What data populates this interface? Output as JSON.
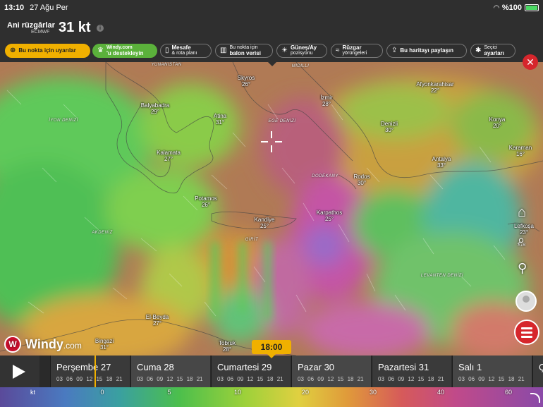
{
  "status": {
    "time": "13:10",
    "date": "27 Ağu Per",
    "battery": "%100"
  },
  "header": {
    "overlay": "Ani rüzgârlar",
    "model": "ECMWF",
    "value": "31 kt"
  },
  "toolbar": {
    "alert": "Bu nokta için uyarılar",
    "support_1": "Windy.com",
    "support_2": "'u destekleyin",
    "distance_1": "Mesafe",
    "distance_2": "& rota planı",
    "balloon_1": "Bu nokta için",
    "balloon_2": "balon verisi",
    "sun_1": "Güneş/Ay",
    "sun_2": "pozisyonu",
    "wind_1": "Rüzgar",
    "wind_2": "yörüngeleri",
    "share": "Bu haritayı paylaşın",
    "settings_1": "Seçici",
    "settings_2": "ayarları"
  },
  "map": {
    "cities": [
      {
        "name": "Balyabadra",
        "value": "29°"
      },
      {
        "name": "Atina",
        "value": "31°"
      },
      {
        "name": "Kalamata",
        "value": "27°"
      },
      {
        "name": "Skyros",
        "value": "26°"
      },
      {
        "name": "İzmir",
        "value": "28°"
      },
      {
        "name": "Afyonkarahisar",
        "value": "22°"
      },
      {
        "name": "Denizli",
        "value": "30°"
      },
      {
        "name": "Konya",
        "value": "20°"
      },
      {
        "name": "Karaman",
        "value": "16°"
      },
      {
        "name": "Antalya",
        "value": "33°"
      },
      {
        "name": "Rodos",
        "value": "30°"
      },
      {
        "name": "Potamos",
        "value": "26°"
      },
      {
        "name": "Kandiye",
        "value": "25°"
      },
      {
        "name": "Karpathos",
        "value": "25°"
      },
      {
        "name": "Lefkoşa",
        "value": "23°"
      },
      {
        "name": "El-Beyda",
        "value": "27°"
      },
      {
        "name": "Bingazi",
        "value": "31°"
      },
      {
        "name": "Tobruk",
        "value": "28°"
      }
    ],
    "seas": [
      "YUNANİSTAN",
      "MIDILLI",
      "İYON DENİZİ",
      "EGE DENİZİ",
      "DODEKANY",
      "AKDENİZ",
      "GİRİT",
      "LEVANTEN DENİZİ",
      "KIB"
    ]
  },
  "timeline": {
    "current_time": "18:00",
    "days": [
      {
        "name": "Perşembe 27",
        "hours": "03 06 09 12 15 18 21"
      },
      {
        "name": "Cuma 28",
        "hours": "03 06 09 12 15 18 21"
      },
      {
        "name": "Cumartesi 29",
        "hours": "03 06 09 12 15 18 21"
      },
      {
        "name": "Pazar 30",
        "hours": "03 06 09 12 15 18 21"
      },
      {
        "name": "Pazartesi 31",
        "hours": "03 06 09 12 15 18 21"
      },
      {
        "name": "Salı 1",
        "hours": "03 06 09 12 15 18 21"
      },
      {
        "name": "Ç",
        "hours": ""
      }
    ]
  },
  "legend": {
    "unit": "kt",
    "ticks": [
      "0",
      "5",
      "10",
      "20",
      "30",
      "40",
      "60"
    ]
  },
  "logo": {
    "name": "Windy",
    "suffix": ".com"
  }
}
